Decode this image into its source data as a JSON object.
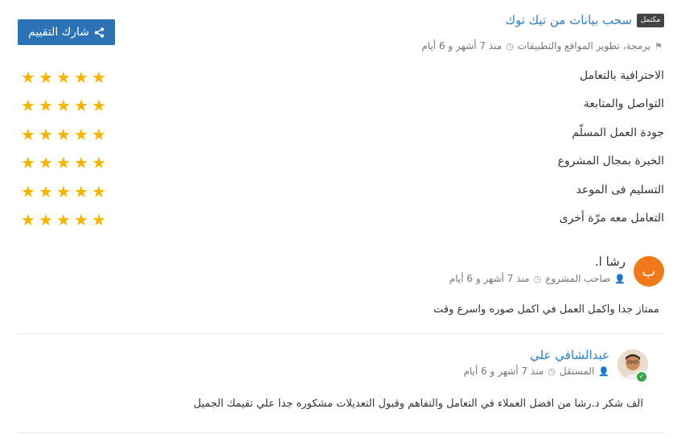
{
  "header": {
    "badge": "مكتمل",
    "project_title": "سحب بيانات من تيك توك",
    "category": "برمجة، تطوير المواقع والتطبيقات",
    "time_ago": "منذ 7 أشهر و 6 أيام",
    "share_button": "شارك التقييم"
  },
  "ratings": [
    {
      "label": "الاحترافية بالتعامل",
      "stars": 5
    },
    {
      "label": "التواصل والمتابعة",
      "stars": 5
    },
    {
      "label": "جودة العمل المسلّم",
      "stars": 5
    },
    {
      "label": "الخبرة بمجال المشروع",
      "stars": 5
    },
    {
      "label": "التسليم فى الموعد",
      "stars": 5
    },
    {
      "label": "التعامل معه مرّة أخرى",
      "stars": 5
    }
  ],
  "owner_review": {
    "avatar_letter": "ب",
    "name": "رشا ا.",
    "role": "صاحب المشروع",
    "time_ago": "منذ 7 أشهر و 6 أيام",
    "text": "ممتاز جدا واكمل العمل في اكمل صوره واسرع وقت"
  },
  "freelancer_review": {
    "name": "عبدالشافي علي",
    "role": "المستقل",
    "time_ago": "منذ 7 أشهر و 6 أيام",
    "text": "الف شكر د.رشا من افضل العملاء في التعامل والتفاهم وقبول التعديلات مشكوره جدا علي تقيمك الجميل"
  },
  "colors": {
    "accent": "#2b73b5",
    "star": "#f5b400",
    "avatar": "#f07a1a",
    "online": "#3aa64a"
  }
}
